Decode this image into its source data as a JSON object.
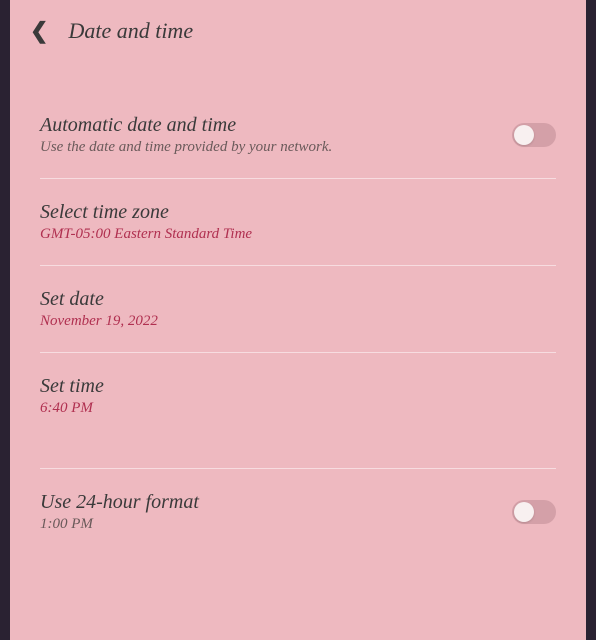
{
  "header": {
    "title": "Date and time"
  },
  "settings": {
    "autoDateTime": {
      "title": "Automatic date and time",
      "subtitle": "Use the date and time provided by your network.",
      "enabled": false
    },
    "timeZone": {
      "title": "Select time zone",
      "value": "GMT-05:00 Eastern Standard Time"
    },
    "setDate": {
      "title": "Set date",
      "value": "November 19, 2022"
    },
    "setTime": {
      "title": "Set time",
      "value": "6:40 PM"
    },
    "format24h": {
      "title": "Use 24-hour format",
      "subtitle": "1:00 PM",
      "enabled": false
    }
  }
}
